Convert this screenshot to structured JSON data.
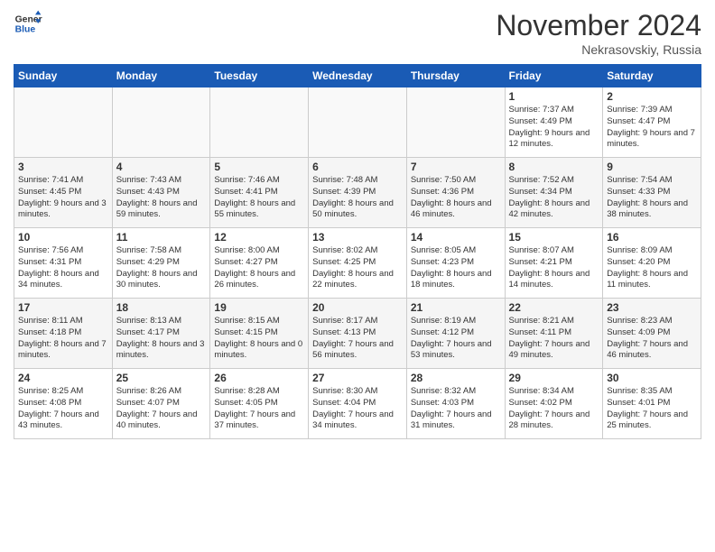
{
  "header": {
    "logo_line1": "General",
    "logo_line2": "Blue",
    "month_title": "November 2024",
    "subtitle": "Nekrasovskiy, Russia"
  },
  "days_of_week": [
    "Sunday",
    "Monday",
    "Tuesday",
    "Wednesday",
    "Thursday",
    "Friday",
    "Saturday"
  ],
  "weeks": [
    [
      {
        "day": "",
        "info": ""
      },
      {
        "day": "",
        "info": ""
      },
      {
        "day": "",
        "info": ""
      },
      {
        "day": "",
        "info": ""
      },
      {
        "day": "",
        "info": ""
      },
      {
        "day": "1",
        "info": "Sunrise: 7:37 AM\nSunset: 4:49 PM\nDaylight: 9 hours and 12 minutes."
      },
      {
        "day": "2",
        "info": "Sunrise: 7:39 AM\nSunset: 4:47 PM\nDaylight: 9 hours and 7 minutes."
      }
    ],
    [
      {
        "day": "3",
        "info": "Sunrise: 7:41 AM\nSunset: 4:45 PM\nDaylight: 9 hours and 3 minutes."
      },
      {
        "day": "4",
        "info": "Sunrise: 7:43 AM\nSunset: 4:43 PM\nDaylight: 8 hours and 59 minutes."
      },
      {
        "day": "5",
        "info": "Sunrise: 7:46 AM\nSunset: 4:41 PM\nDaylight: 8 hours and 55 minutes."
      },
      {
        "day": "6",
        "info": "Sunrise: 7:48 AM\nSunset: 4:39 PM\nDaylight: 8 hours and 50 minutes."
      },
      {
        "day": "7",
        "info": "Sunrise: 7:50 AM\nSunset: 4:36 PM\nDaylight: 8 hours and 46 minutes."
      },
      {
        "day": "8",
        "info": "Sunrise: 7:52 AM\nSunset: 4:34 PM\nDaylight: 8 hours and 42 minutes."
      },
      {
        "day": "9",
        "info": "Sunrise: 7:54 AM\nSunset: 4:33 PM\nDaylight: 8 hours and 38 minutes."
      }
    ],
    [
      {
        "day": "10",
        "info": "Sunrise: 7:56 AM\nSunset: 4:31 PM\nDaylight: 8 hours and 34 minutes."
      },
      {
        "day": "11",
        "info": "Sunrise: 7:58 AM\nSunset: 4:29 PM\nDaylight: 8 hours and 30 minutes."
      },
      {
        "day": "12",
        "info": "Sunrise: 8:00 AM\nSunset: 4:27 PM\nDaylight: 8 hours and 26 minutes."
      },
      {
        "day": "13",
        "info": "Sunrise: 8:02 AM\nSunset: 4:25 PM\nDaylight: 8 hours and 22 minutes."
      },
      {
        "day": "14",
        "info": "Sunrise: 8:05 AM\nSunset: 4:23 PM\nDaylight: 8 hours and 18 minutes."
      },
      {
        "day": "15",
        "info": "Sunrise: 8:07 AM\nSunset: 4:21 PM\nDaylight: 8 hours and 14 minutes."
      },
      {
        "day": "16",
        "info": "Sunrise: 8:09 AM\nSunset: 4:20 PM\nDaylight: 8 hours and 11 minutes."
      }
    ],
    [
      {
        "day": "17",
        "info": "Sunrise: 8:11 AM\nSunset: 4:18 PM\nDaylight: 8 hours and 7 minutes."
      },
      {
        "day": "18",
        "info": "Sunrise: 8:13 AM\nSunset: 4:17 PM\nDaylight: 8 hours and 3 minutes."
      },
      {
        "day": "19",
        "info": "Sunrise: 8:15 AM\nSunset: 4:15 PM\nDaylight: 8 hours and 0 minutes."
      },
      {
        "day": "20",
        "info": "Sunrise: 8:17 AM\nSunset: 4:13 PM\nDaylight: 7 hours and 56 minutes."
      },
      {
        "day": "21",
        "info": "Sunrise: 8:19 AM\nSunset: 4:12 PM\nDaylight: 7 hours and 53 minutes."
      },
      {
        "day": "22",
        "info": "Sunrise: 8:21 AM\nSunset: 4:11 PM\nDaylight: 7 hours and 49 minutes."
      },
      {
        "day": "23",
        "info": "Sunrise: 8:23 AM\nSunset: 4:09 PM\nDaylight: 7 hours and 46 minutes."
      }
    ],
    [
      {
        "day": "24",
        "info": "Sunrise: 8:25 AM\nSunset: 4:08 PM\nDaylight: 7 hours and 43 minutes."
      },
      {
        "day": "25",
        "info": "Sunrise: 8:26 AM\nSunset: 4:07 PM\nDaylight: 7 hours and 40 minutes."
      },
      {
        "day": "26",
        "info": "Sunrise: 8:28 AM\nSunset: 4:05 PM\nDaylight: 7 hours and 37 minutes."
      },
      {
        "day": "27",
        "info": "Sunrise: 8:30 AM\nSunset: 4:04 PM\nDaylight: 7 hours and 34 minutes."
      },
      {
        "day": "28",
        "info": "Sunrise: 8:32 AM\nSunset: 4:03 PM\nDaylight: 7 hours and 31 minutes."
      },
      {
        "day": "29",
        "info": "Sunrise: 8:34 AM\nSunset: 4:02 PM\nDaylight: 7 hours and 28 minutes."
      },
      {
        "day": "30",
        "info": "Sunrise: 8:35 AM\nSunset: 4:01 PM\nDaylight: 7 hours and 25 minutes."
      }
    ]
  ]
}
